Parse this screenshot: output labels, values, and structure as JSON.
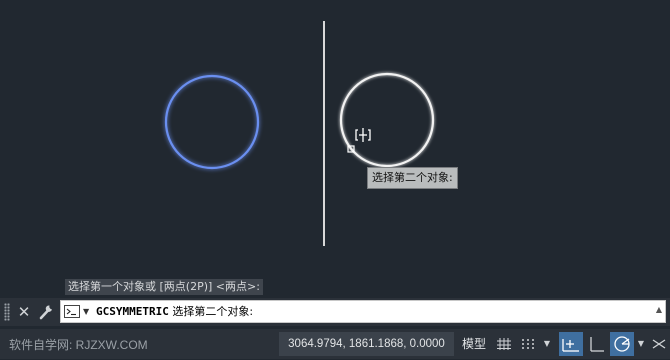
{
  "canvas": {
    "tooltip_text": "选择第二个对象:",
    "prev_command_line": "选择第一个对象或 [两点(2P)] <两点>:"
  },
  "command": {
    "name": "GCSYMMETRIC",
    "prompt": "选择第二个对象:"
  },
  "status": {
    "watermark": "软件自学网: RJZXW.COM",
    "coordinates": "3064.9794, 1861.1868, 0.0000",
    "model_label": "模型"
  },
  "colors": {
    "background": "#212830",
    "selected_circle": "#6b8ff0",
    "circle": "#ffffff",
    "axis_line": "#d8d8d8",
    "accent": "#3f6fa0"
  }
}
